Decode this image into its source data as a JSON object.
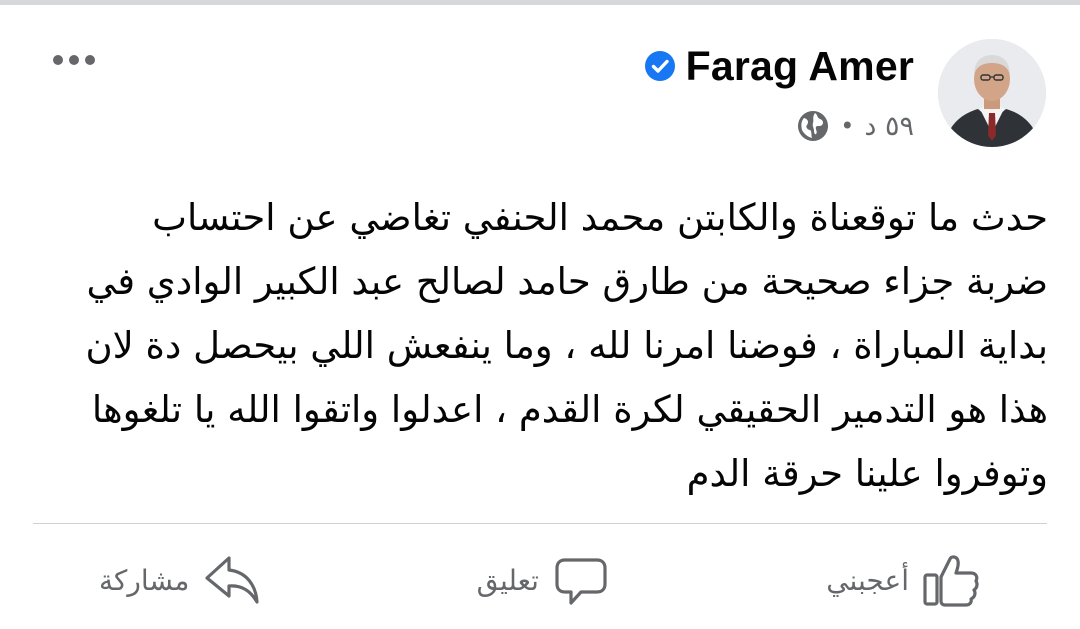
{
  "post": {
    "author": {
      "name": "Farag Amer",
      "verified": true,
      "avatar_icon": "profile-photo"
    },
    "meta": {
      "timestamp": "٥٩ د",
      "separator": "•",
      "audience_icon": "globe-icon"
    },
    "more_icon": "more-options-icon",
    "text_lines": [
      "حدث ما توقعناة  والكابتن محمد الحنفي تغاضي عن احتساب",
      "ضربة جزاء صحيحة  من طارق حامد لصالح عبد الكبير الوادي في",
      "بداية المباراة ، فوضنا امرنا لله ، وما ينفعش اللي بيحصل دة لان",
      "هذا هو التدمير الحقيقي لكرة القدم ، اعدلوا واتقوا الله يا تلغوها",
      "وتوفروا علينا  حرقة الدم"
    ]
  },
  "actions": {
    "like": {
      "label": "أعجبني",
      "icon": "thumbs-up-icon"
    },
    "comment": {
      "label": "تعليق",
      "icon": "comment-bubble-icon"
    },
    "share": {
      "label": "مشاركة",
      "icon": "share-arrow-icon"
    }
  },
  "colors": {
    "text_primary": "#050505",
    "text_secondary": "#65676b",
    "verified_badge": "#1877f2",
    "divider": "#ced0d4"
  }
}
